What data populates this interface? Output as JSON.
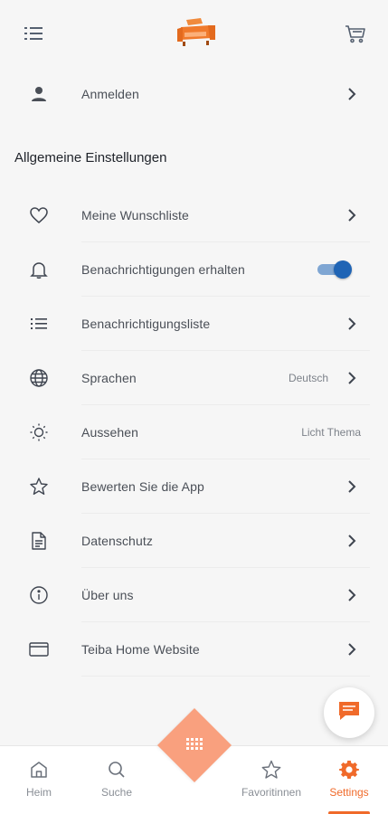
{
  "account": {
    "login_label": "Anmelden"
  },
  "section": {
    "title": "Allgemeine Einstellungen"
  },
  "settings": {
    "wishlist": "Meine Wunschliste",
    "notifications": "Benachrichtigungen erhalten",
    "notifications_enabled": true,
    "notification_list": "Benachrichtigungsliste",
    "languages": "Sprachen",
    "language_value": "Deutsch",
    "appearance": "Aussehen",
    "appearance_value": "Licht Thema",
    "rate_app": "Bewerten Sie die App",
    "privacy": "Datenschutz",
    "about": "Über uns",
    "website": "Teiba Home Website"
  },
  "bottom_nav": {
    "home": "Heim",
    "search": "Suche",
    "favorites": "Favoritinnen",
    "settings": "Settings",
    "active": "settings"
  },
  "icons": {
    "menu": "list-icon",
    "cart": "cart-icon",
    "logo": "sofa-logo",
    "chat": "chat-icon",
    "center": "grid-icon"
  },
  "colors": {
    "accent": "#f06a2a",
    "fab": "#f9a07e",
    "toggle_on": "#1f64b5",
    "background": "#f6f6f6",
    "text": "#4a4f57"
  }
}
